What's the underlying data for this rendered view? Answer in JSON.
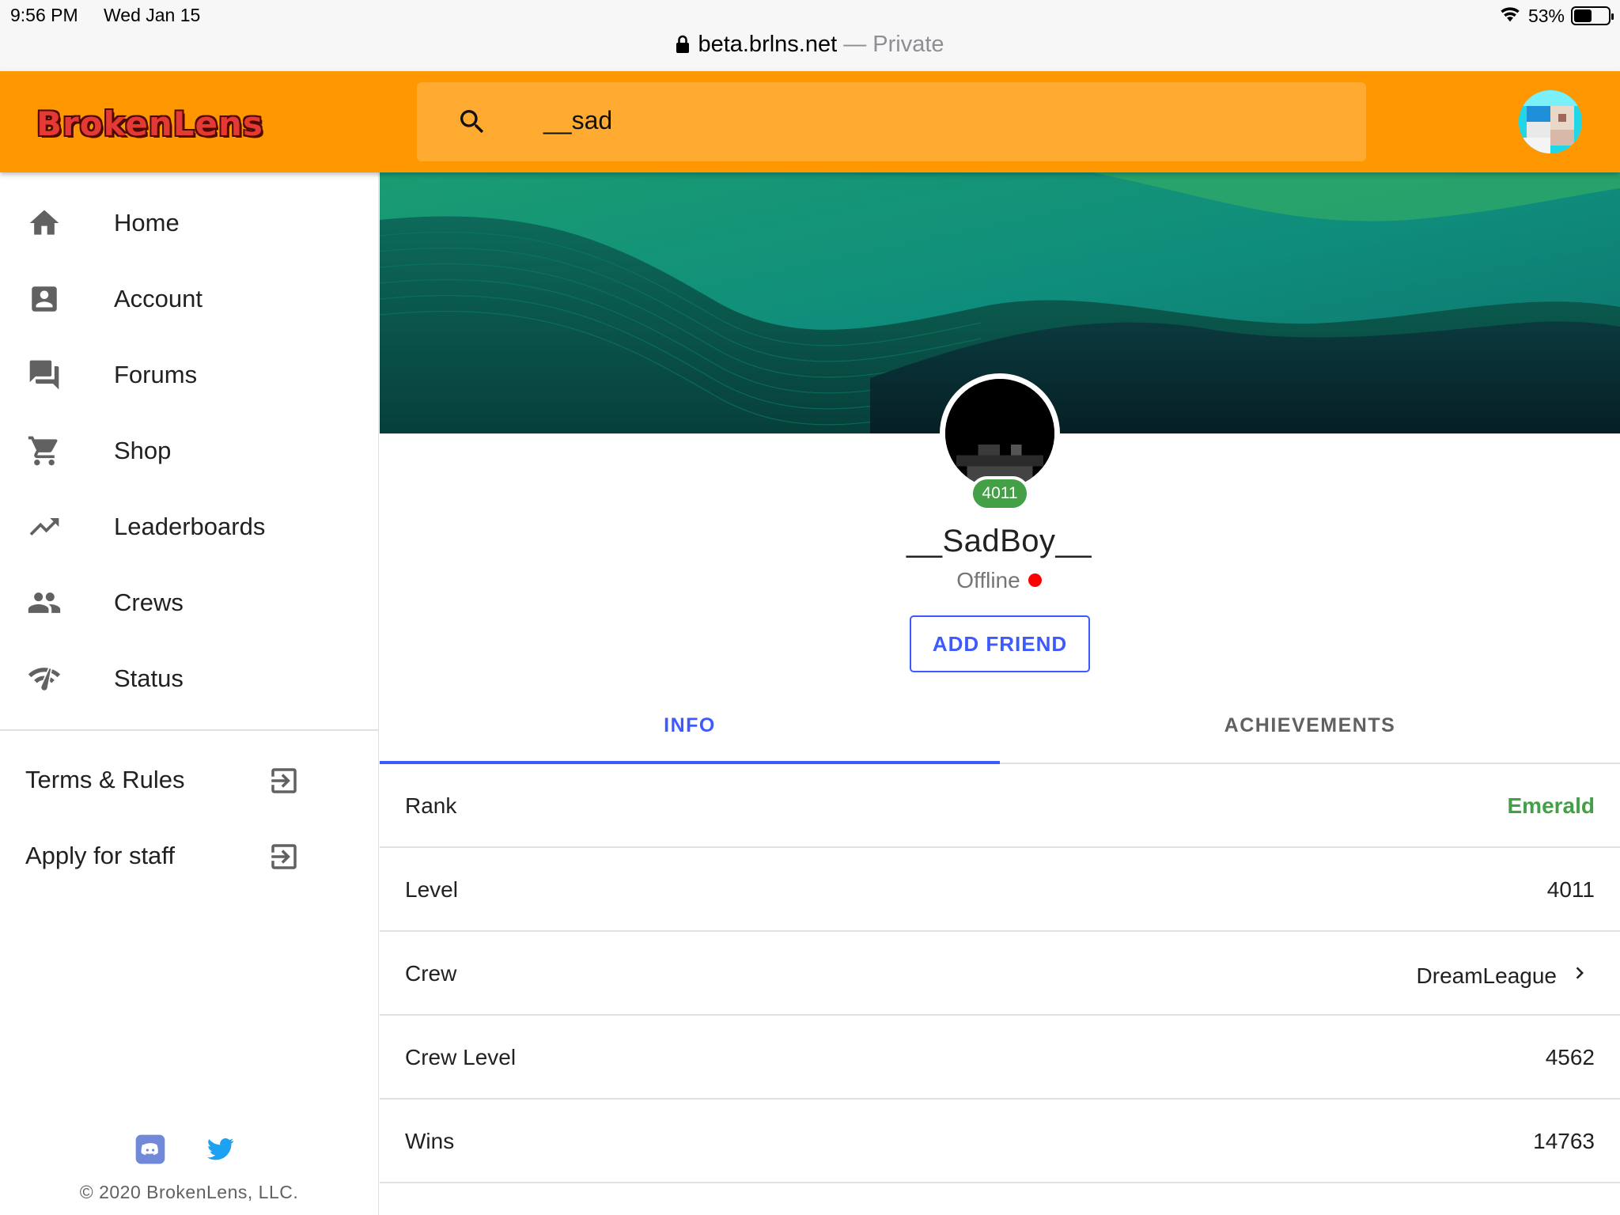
{
  "status_bar": {
    "time": "9:56 PM",
    "date": "Wed Jan 15",
    "battery": "53%",
    "battery_level": 0.53
  },
  "browser": {
    "host": "beta.brlns.net",
    "separator": " — ",
    "mode": "Private"
  },
  "appbar": {
    "logo": "BrokenLens",
    "search_value": "__sad",
    "accent": "#ff9800"
  },
  "sidebar": {
    "items": [
      {
        "label": "Home",
        "icon": "home-icon"
      },
      {
        "label": "Account",
        "icon": "account-box-icon"
      },
      {
        "label": "Forums",
        "icon": "forum-icon"
      },
      {
        "label": "Shop",
        "icon": "cart-icon"
      },
      {
        "label": "Leaderboards",
        "icon": "trending-up-icon"
      },
      {
        "label": "Crews",
        "icon": "people-icon"
      },
      {
        "label": "Status",
        "icon": "network-check-icon"
      }
    ],
    "external": [
      {
        "label": "Terms & Rules",
        "icon": "open-link-icon"
      },
      {
        "label": "Apply for staff",
        "icon": "open-link-icon"
      }
    ],
    "copyright": "© 2020 BrokenLens, LLC."
  },
  "profile": {
    "level_badge": "4011",
    "username": "__SadBoy__",
    "status": "Offline",
    "status_color": "#ff0000",
    "add_friend": "ADD FRIEND"
  },
  "tabs": [
    {
      "label": "INFO",
      "active": true
    },
    {
      "label": "ACHIEVEMENTS",
      "active": false
    }
  ],
  "info": {
    "rows": [
      {
        "key": "Rank",
        "value": "Emerald"
      },
      {
        "key": "Level",
        "value": "4011"
      },
      {
        "key": "Crew",
        "value": "DreamLeague"
      },
      {
        "key": "Crew Level",
        "value": "4562"
      },
      {
        "key": "Wins",
        "value": "14763"
      }
    ],
    "rank_color": "#43a047"
  }
}
